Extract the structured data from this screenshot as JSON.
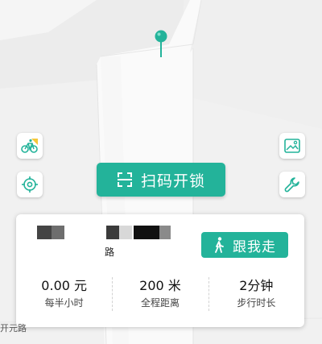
{
  "map": {
    "street_label": "开元路",
    "pin_icon": "map-pin-icon"
  },
  "buttons": {
    "scan_label": "扫码开锁",
    "bike_icon": "bike-icon",
    "locate_icon": "locate-icon",
    "image_icon": "image-icon",
    "wrench_icon": "wrench-icon",
    "scan_icon": "scan-icon"
  },
  "card": {
    "road_label": "路",
    "follow_label": "跟我走",
    "walk_icon": "walk-icon",
    "stats": [
      {
        "value": "0.00 元",
        "label": "每半小时"
      },
      {
        "value": "200 米",
        "label": "全程距离"
      },
      {
        "value": "2分钟",
        "label": "步行时长"
      }
    ]
  },
  "colors": {
    "accent": "#23b39a",
    "map_background": "#f2f2f2",
    "road": "#ffffff"
  }
}
